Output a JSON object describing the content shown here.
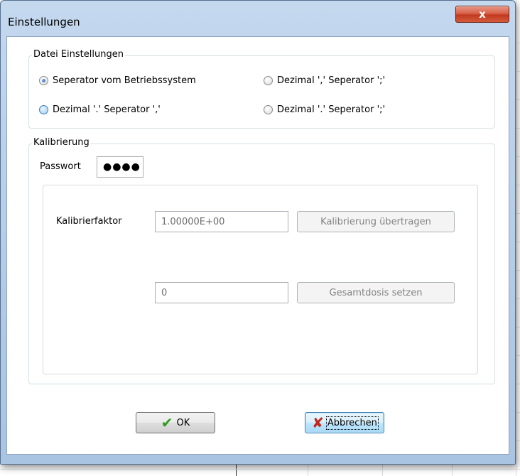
{
  "window": {
    "title": "Einstellungen",
    "close_glyph": "x"
  },
  "file_settings": {
    "legend": "Datei Einstellungen",
    "options": [
      {
        "label": "Seperator vom Betriebssystem",
        "checked": true
      },
      {
        "label": "Dezimal ',' Seperator ';'",
        "checked": false
      },
      {
        "label": "Dezimal '.' Seperator ','",
        "checked": false
      },
      {
        "label": "Dezimal '.' Seperator ';'",
        "checked": false
      }
    ]
  },
  "calibration": {
    "legend": "Kalibrierung",
    "password_label": "Passwort",
    "password_value": "●●●●",
    "factor_label": "Kalibrierfaktor",
    "factor_value": "1.00000E+00",
    "transfer_button": "Kalibrierung übertragen",
    "dose_value": "0",
    "dose_button": "Gesamtdosis setzen"
  },
  "footer": {
    "ok_label": "OK",
    "ok_icon": "checkmark-icon",
    "cancel_label": "Abbrechen",
    "cancel_icon": "cross-icon"
  }
}
